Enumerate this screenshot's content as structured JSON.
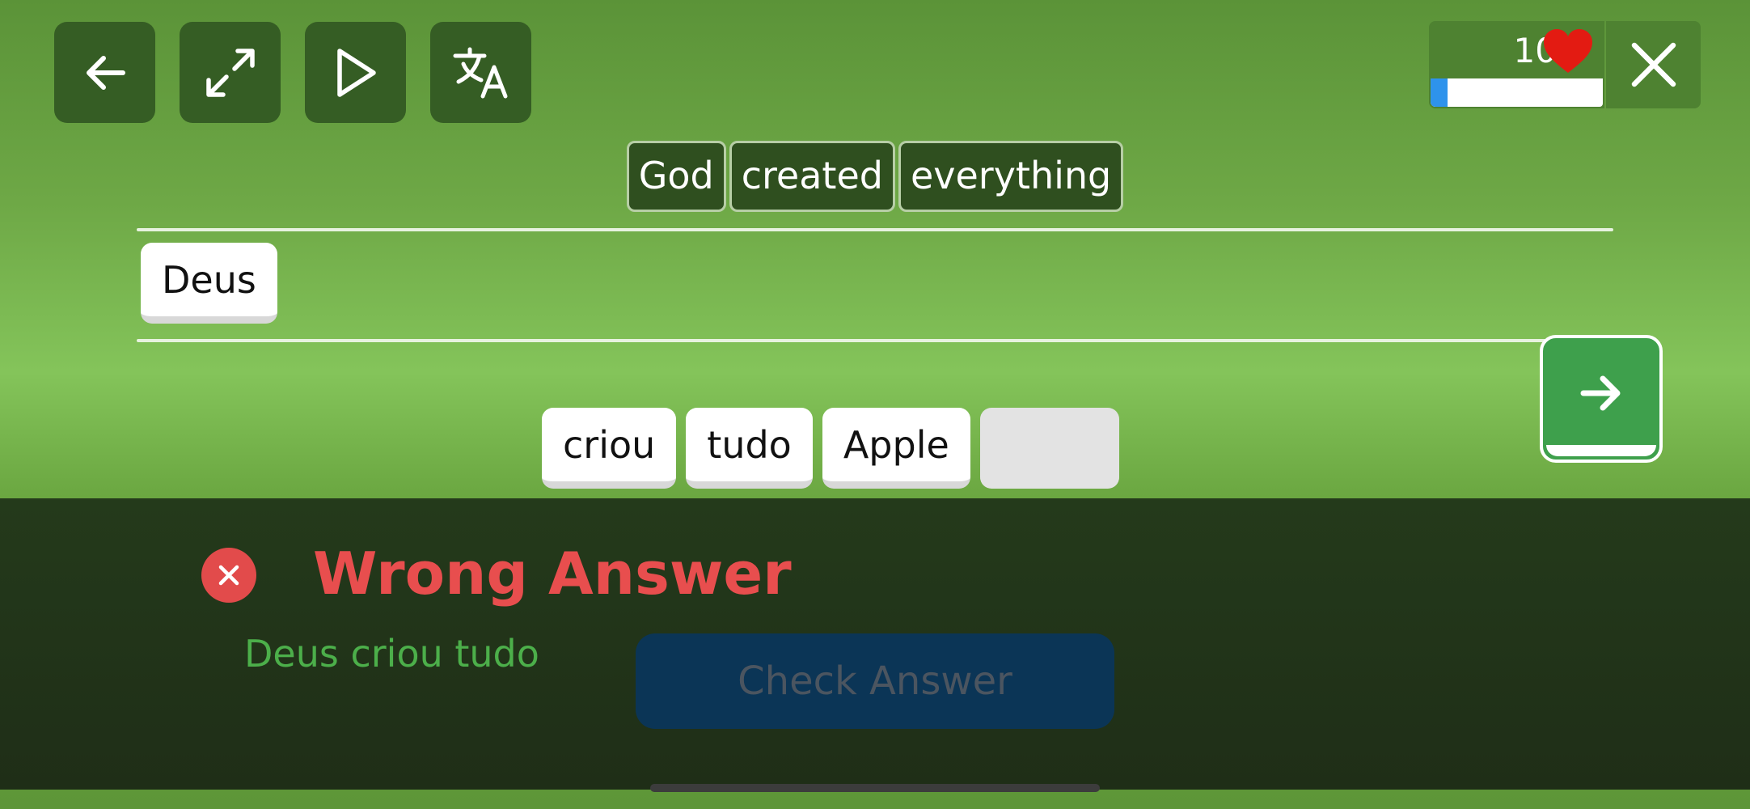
{
  "toolbar": {
    "back_icon": "arrow-left-icon",
    "fullscreen_icon": "expand-icon",
    "play_icon": "play-icon",
    "translate_icon": "translate-icon"
  },
  "status": {
    "lives": "10",
    "lives_icon": "heart-icon",
    "progress_fraction": 0.1,
    "close_icon": "close-icon"
  },
  "prompt": {
    "words": [
      "God",
      "created",
      "everything"
    ]
  },
  "answer": {
    "words": [
      "Deus"
    ]
  },
  "word_bank": {
    "words": [
      "criou",
      "tudo",
      "Apple"
    ]
  },
  "next_icon": "arrow-right-icon",
  "feedback": {
    "title": "Wrong Answer",
    "correct_answer": "Deus criou tudo",
    "check_button": "Check Answer",
    "status_icon": "close-circle-icon"
  },
  "colors": {
    "wrong": "#e84e4e",
    "correct": "#4caf4a",
    "accent": "#2e93ec",
    "next_button": "#3ea04c"
  }
}
